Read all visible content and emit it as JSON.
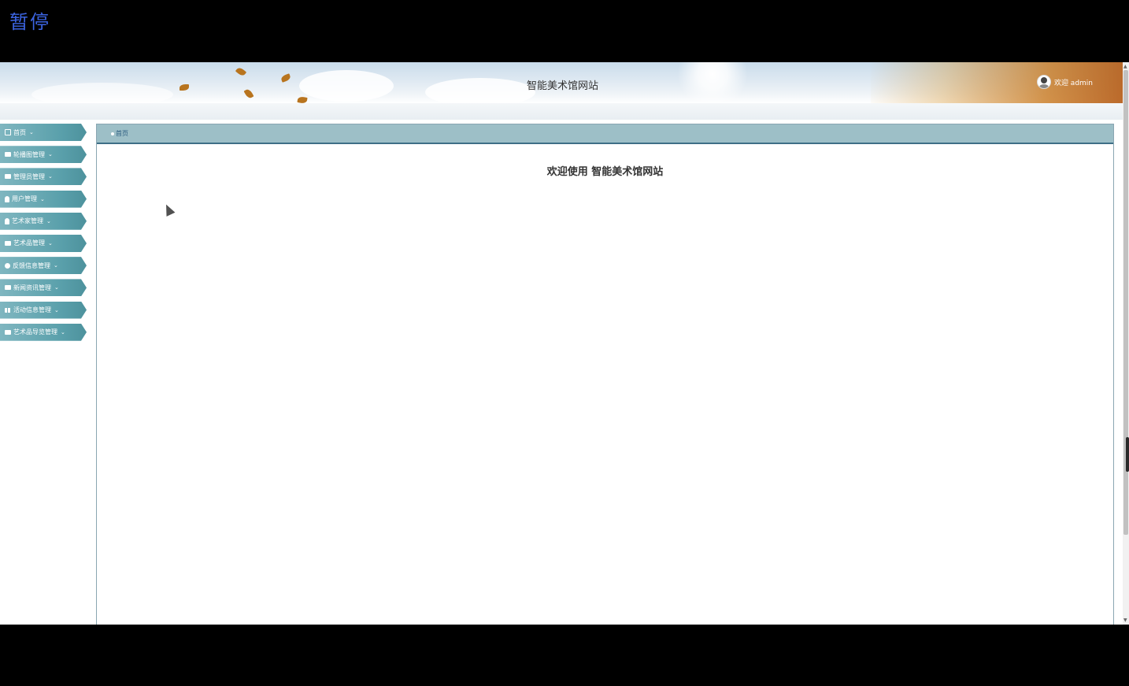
{
  "overlay": {
    "pause_label": "暂停"
  },
  "header": {
    "title": "智能美术馆网站",
    "user_greeting": "欢迎 admin"
  },
  "sidebar": {
    "items": [
      {
        "label": "首页",
        "icon": "home-icon"
      },
      {
        "label": "轮播图管理",
        "icon": "image-icon"
      },
      {
        "label": "管理员管理",
        "icon": "list-icon"
      },
      {
        "label": "用户管理",
        "icon": "user-icon"
      },
      {
        "label": "艺术家管理",
        "icon": "user-icon"
      },
      {
        "label": "艺术品管理",
        "icon": "book-icon"
      },
      {
        "label": "反馈信息管理",
        "icon": "circle-icon"
      },
      {
        "label": "新闻资讯管理",
        "icon": "image-icon"
      },
      {
        "label": "活动信息管理",
        "icon": "grid-icon"
      },
      {
        "label": "艺术品导览管理",
        "icon": "list-icon"
      }
    ],
    "chevron": "⌄"
  },
  "breadcrumb": {
    "home": "首页"
  },
  "main": {
    "welcome_text": "欢迎使用 智能美术馆网站"
  },
  "colors": {
    "sidebar_item": "#5aa0ab",
    "breadcrumb_bar": "#9dbfc7",
    "breadcrumb_border": "#3e6f86",
    "pause_label": "#3b63e0"
  }
}
